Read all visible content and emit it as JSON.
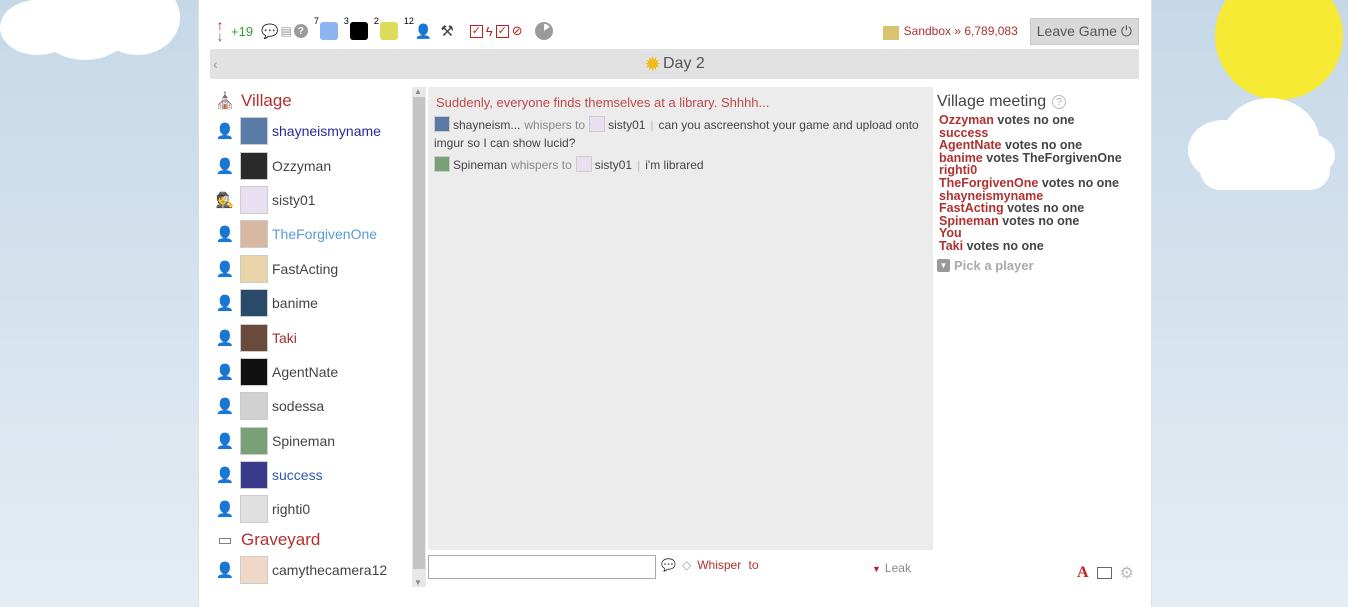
{
  "topbar": {
    "rep_value": "+19",
    "count_blue": "7",
    "count_black": "3",
    "count_yellow": "2",
    "count_people": "12",
    "square_colors": [
      "#8db4f0",
      "#000000",
      "#dcdc5a"
    ],
    "icons": [
      "rep-arrows-icon",
      "chat-bubble-icon",
      "book-icon",
      "help-icon",
      "people-icon",
      "tools-icon",
      "checkbox-icon",
      "lightning-icon",
      "hidden-eye-icon",
      "pie-timer-icon"
    ],
    "sandbox_label": "Sandbox » 6,789,083",
    "leave_label": "Leave Game"
  },
  "day": {
    "back_label": "‹",
    "label": "Day 2"
  },
  "village": {
    "title": "Village",
    "players": [
      {
        "name": "shayneismyname",
        "color": "#2a2a9a",
        "avatar": "#5a7aa8",
        "icon": "person"
      },
      {
        "name": "Ozzyman",
        "color": "#444444",
        "avatar": "#2a2a2a",
        "icon": "person"
      },
      {
        "name": "sisty01",
        "color": "#444444",
        "avatar": "#e8e0f0",
        "icon": "spy"
      },
      {
        "name": "TheForgivenOne",
        "color": "#5a9ad8",
        "avatar": "#d8b8a0",
        "icon": "person"
      },
      {
        "name": "FastActing",
        "color": "#444444",
        "avatar": "#e8d4a8",
        "icon": "person"
      },
      {
        "name": "banime",
        "color": "#444444",
        "avatar": "#2a4a6a",
        "icon": "person"
      },
      {
        "name": "Taki",
        "color": "#a03030",
        "avatar": "#6a4a3a",
        "icon": "person"
      },
      {
        "name": "AgentNate",
        "color": "#444444",
        "avatar": "#111111",
        "icon": "person"
      },
      {
        "name": "sodessa",
        "color": "#444444",
        "avatar": "#d0d0d0",
        "icon": "person"
      },
      {
        "name": "Spineman",
        "color": "#444444",
        "avatar": "#7aa078",
        "icon": "person"
      },
      {
        "name": "success",
        "color": "#2a5aaa",
        "avatar": "#3a3a8a",
        "icon": "person"
      },
      {
        "name": "righti0",
        "color": "#444444",
        "avatar": "#e0e0e0",
        "icon": "person"
      }
    ]
  },
  "graveyard": {
    "title": "Graveyard",
    "players": [
      {
        "name": "camythecamera12",
        "color": "#444444",
        "avatar": "#f0d8c8",
        "icon": "townsperson"
      }
    ]
  },
  "chat": {
    "announcement": "Suddenly, everyone finds themselves at a library. Shhhh...",
    "messages": [
      {
        "sender": "shayneism...",
        "whisper_label": "whispers to",
        "recipient": "sisty01",
        "text": "can you ascreenshot your game and upload onto imgur so I can show lucid?",
        "sender_avatar": "#5a7aa8",
        "recipient_avatar": "#e8e0f0"
      },
      {
        "sender": "Spineman",
        "whisper_label": "whispers to",
        "recipient": "sisty01",
        "text": "i'm librared",
        "sender_avatar": "#7aa078",
        "recipient_avatar": "#e8e0f0"
      }
    ]
  },
  "input": {
    "value": "",
    "whisper_label": "Whisper",
    "to_label": "to",
    "leak_label": "Leak"
  },
  "meeting": {
    "title": "Village meeting",
    "votes": [
      {
        "voter": "Ozzyman",
        "action": "votes no one"
      },
      {
        "voter": "success",
        "action": ""
      },
      {
        "voter": "AgentNate",
        "action": "votes no one"
      },
      {
        "voter": "banime",
        "action": "votes TheForgivenOne"
      },
      {
        "voter": "righti0",
        "action": ""
      },
      {
        "voter": "TheForgivenOne",
        "action": "votes no one"
      },
      {
        "voter": "shayneismyname",
        "action": ""
      },
      {
        "voter": "FastActing",
        "action": "votes no one"
      },
      {
        "voter": "Spineman",
        "action": "votes no one"
      },
      {
        "voter": "You",
        "action": ""
      },
      {
        "voter": "Taki",
        "action": "votes no one"
      }
    ],
    "pick_label": "Pick a player"
  }
}
